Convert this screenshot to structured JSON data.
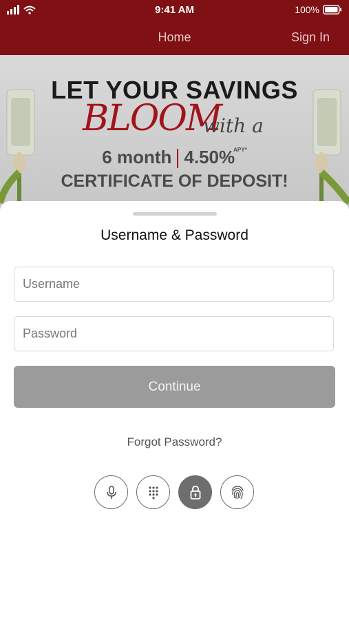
{
  "status": {
    "time": "9:41 AM",
    "battery": "100%"
  },
  "nav": {
    "title": "Home",
    "sign_in": "Sign In"
  },
  "banner": {
    "line1": "LET YOUR SAVINGS",
    "bloom": "BLOOM",
    "with_a": "with a",
    "term": "6 month",
    "rate": "4.50%",
    "apy": "APY*",
    "line3": "CERTIFICATE OF DEPOSIT!"
  },
  "login": {
    "title": "Username & Password",
    "username_placeholder": "Username",
    "password_placeholder": "Password",
    "continue_label": "Continue",
    "forgot_label": "Forgot Password?"
  },
  "auth_methods": [
    {
      "name": "microphone-icon",
      "active": false
    },
    {
      "name": "keypad-icon",
      "active": false
    },
    {
      "name": "lock-icon",
      "active": true
    },
    {
      "name": "fingerprint-icon",
      "active": false
    }
  ]
}
